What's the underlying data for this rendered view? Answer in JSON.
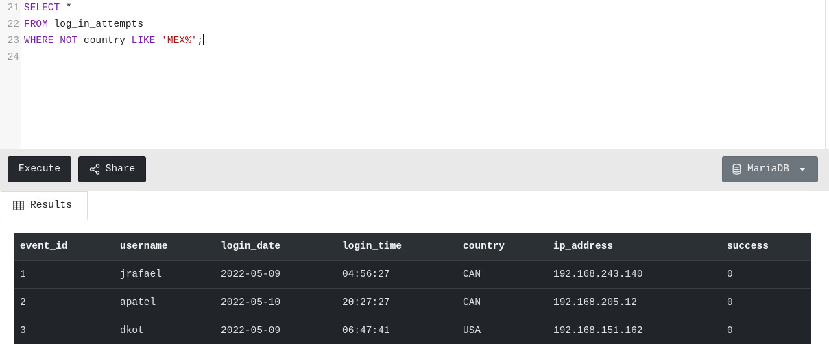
{
  "editor": {
    "lines": [
      {
        "number": "21",
        "tokens": [
          {
            "t": "kw",
            "v": "SELECT"
          },
          {
            "t": "plain",
            "v": " *"
          }
        ]
      },
      {
        "number": "22",
        "tokens": [
          {
            "t": "kw",
            "v": "FROM"
          },
          {
            "t": "plain",
            "v": " log_in_attempts"
          }
        ]
      },
      {
        "number": "23",
        "tokens": [
          {
            "t": "kw",
            "v": "WHERE"
          },
          {
            "t": "plain",
            "v": " "
          },
          {
            "t": "kw",
            "v": "NOT"
          },
          {
            "t": "plain",
            "v": " country "
          },
          {
            "t": "kw",
            "v": "LIKE"
          },
          {
            "t": "plain",
            "v": " "
          },
          {
            "t": "str",
            "v": "'MEX%'"
          },
          {
            "t": "plain",
            "v": ";"
          }
        ]
      },
      {
        "number": "24",
        "tokens": []
      }
    ]
  },
  "toolbar": {
    "execute_label": "Execute",
    "share_label": "Share",
    "share_icon": "share-icon",
    "db_label": "MariaDB",
    "db_icon": "database-icon"
  },
  "tabs": [
    {
      "label": "Results",
      "icon": "table-icon",
      "active": true
    }
  ],
  "results": {
    "columns": [
      "event_id",
      "username",
      "login_date",
      "login_time",
      "country",
      "ip_address",
      "success"
    ],
    "rows": [
      [
        "1",
        "jrafael",
        "2022-05-09",
        "04:56:27",
        "CAN",
        "192.168.243.140",
        "0"
      ],
      [
        "2",
        "apatel",
        "2022-05-10",
        "20:27:27",
        "CAN",
        "192.168.205.12",
        "0"
      ],
      [
        "3",
        "dkot",
        "2022-05-09",
        "06:47:41",
        "USA",
        "192.168.151.162",
        "0"
      ]
    ]
  },
  "colors": {
    "keyword": "#7a1fa0",
    "string": "#a31515",
    "button_dark": "#25292d",
    "button_gray": "#6e767d",
    "table_bg": "#212529"
  }
}
